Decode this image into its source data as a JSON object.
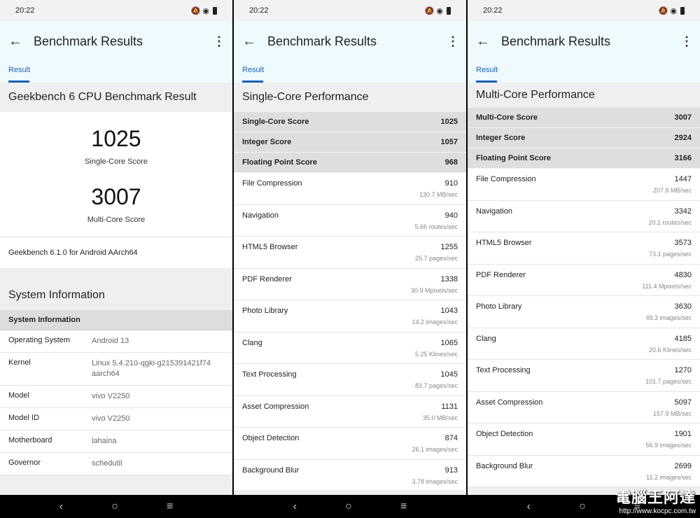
{
  "status": {
    "time": "20:22",
    "icons": "🔕 ◉"
  },
  "appbar": {
    "title": "Benchmark Results",
    "back": "←",
    "menu": "⋮"
  },
  "tab": {
    "label": "Result"
  },
  "p1": {
    "heading": "Geekbench 6 CPU Benchmark Result",
    "single": {
      "value": "1025",
      "label": "Single-Core Score"
    },
    "multi": {
      "value": "3007",
      "label": "Multi-Core Score"
    },
    "version": "Geekbench 6.1.0 for Android AArch64",
    "sys_title": "System Information",
    "sys_header": "System Information",
    "sys_rows": [
      {
        "k": "Operating System",
        "v": "Android 13"
      },
      {
        "k": "Kernel",
        "v": "Linux 5.4.210-qgki-g215391421f74 aarch64"
      },
      {
        "k": "Model",
        "v": "vivo V2250"
      },
      {
        "k": "Model ID",
        "v": "vivo V2250"
      },
      {
        "k": "Motherboard",
        "v": "lahaina"
      },
      {
        "k": "Governor",
        "v": "schedutil"
      }
    ]
  },
  "p2": {
    "heading": "Single-Core Performance",
    "scores": [
      {
        "k": "Single-Core Score",
        "v": "1025"
      },
      {
        "k": "Integer Score",
        "v": "1057"
      },
      {
        "k": "Floating Point Score",
        "v": "968"
      }
    ],
    "benches": [
      {
        "name": "File Compression",
        "value": "910",
        "rate": "130.7 MB/sec"
      },
      {
        "name": "Navigation",
        "value": "940",
        "rate": "5.66 routes/sec"
      },
      {
        "name": "HTML5 Browser",
        "value": "1255",
        "rate": "25.7 pages/sec"
      },
      {
        "name": "PDF Renderer",
        "value": "1338",
        "rate": "30.9 Mpixels/sec"
      },
      {
        "name": "Photo Library",
        "value": "1043",
        "rate": "14.2 images/sec"
      },
      {
        "name": "Clang",
        "value": "1065",
        "rate": "5.25 Klines/sec"
      },
      {
        "name": "Text Processing",
        "value": "1045",
        "rate": "83.7 pages/sec"
      },
      {
        "name": "Asset Compression",
        "value": "1131",
        "rate": "35.0 MB/sec"
      },
      {
        "name": "Object Detection",
        "value": "874",
        "rate": "26.1 images/sec"
      },
      {
        "name": "Background Blur",
        "value": "913",
        "rate": "3.78 images/sec"
      }
    ]
  },
  "p3": {
    "heading": "Multi-Core Performance",
    "scores": [
      {
        "k": "Multi-Core Score",
        "v": "3007"
      },
      {
        "k": "Integer Score",
        "v": "2924"
      },
      {
        "k": "Floating Point Score",
        "v": "3166"
      }
    ],
    "benches": [
      {
        "name": "File Compression",
        "value": "1447",
        "rate": "207.8 MB/sec"
      },
      {
        "name": "Navigation",
        "value": "3342",
        "rate": "20.1 routes/sec"
      },
      {
        "name": "HTML5 Browser",
        "value": "3573",
        "rate": "73.1 pages/sec"
      },
      {
        "name": "PDF Renderer",
        "value": "4830",
        "rate": "111.4 Mpixels/sec"
      },
      {
        "name": "Photo Library",
        "value": "3630",
        "rate": "49.3 images/sec"
      },
      {
        "name": "Clang",
        "value": "4185",
        "rate": "20.6 Klines/sec"
      },
      {
        "name": "Text Processing",
        "value": "1270",
        "rate": "101.7 pages/sec"
      },
      {
        "name": "Asset Compression",
        "value": "5097",
        "rate": "157.9 MB/sec"
      },
      {
        "name": "Object Detection",
        "value": "1901",
        "rate": "56.9 images/sec"
      },
      {
        "name": "Background Blur",
        "value": "2699",
        "rate": "11.2 images/sec"
      }
    ]
  },
  "nav": {
    "back": "‹",
    "home": "○",
    "recents": "≡"
  },
  "watermark": {
    "title": "電腦王阿達",
    "url": "http://www.kocpc.com.tw"
  }
}
